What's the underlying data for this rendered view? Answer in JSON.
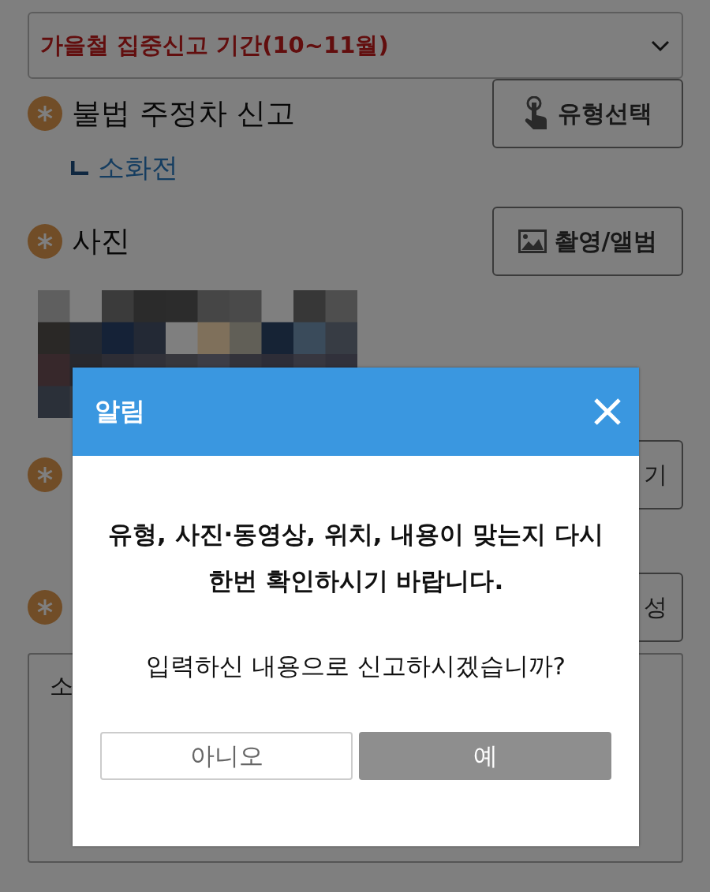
{
  "form": {
    "period_select": {
      "value": "가을철 집중신고 기간(10~11월)"
    },
    "fields": [
      {
        "kind": "type",
        "title": "불법 주정차 신고",
        "button": "유형선택",
        "sub": "소화전"
      },
      {
        "title": "사진",
        "button": "촬영/앨범"
      },
      {
        "kind": "covered",
        "button": "기"
      },
      {
        "kind": "covered",
        "button": "성"
      }
    ],
    "content": {
      "value": "소"
    }
  },
  "dialog": {
    "title": "알림",
    "message": "유형, 사진·동영상, 위치, 내용이 맞는지 다시 한번 확인하시기 바랍니다.",
    "question": "입력하신 내용으로 신고하시겠습니까?",
    "buttons": [
      {
        "label": "아니오",
        "kind": "cancel"
      },
      {
        "label": "예",
        "kind": "confirm"
      }
    ]
  }
}
